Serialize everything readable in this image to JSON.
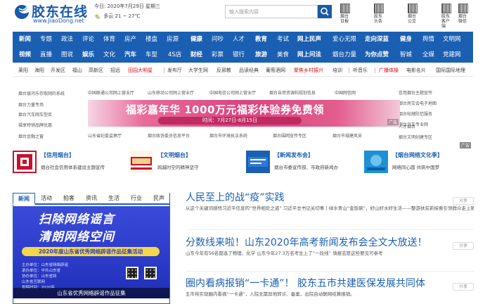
{
  "header": {
    "logo_text": "胶东在线",
    "logo_url": "www.JiaoDong.net",
    "date_label": "今日:",
    "date": "2020年7月29日 星期三",
    "weather": "多云 21 ~ 27℃",
    "search_placeholder": "输入搜索内容",
    "qr_codes": [
      {
        "label": "烟台日报"
      },
      {
        "label": "胶东头条"
      },
      {
        "label": "烟台公交"
      },
      {
        "label": "胶东客户端"
      },
      {
        "label": "烟台微信"
      }
    ]
  },
  "nav": {
    "row1": [
      "新闻",
      "专题",
      "政法",
      "评论",
      "体育",
      "房产",
      "楼盘",
      "房源",
      "健康",
      "问吵",
      "人才",
      "教育",
      "考试",
      "网上民声",
      "爱心无限",
      "走向深蓝",
      "健身",
      "舆情",
      "文明网"
    ],
    "row2": [
      "视频",
      "直播",
      "图说",
      "娱乐",
      "文化",
      "汽车",
      "车型",
      "4S店",
      "财经",
      "彩票",
      "银行",
      "旅游",
      "美食",
      "网上问法",
      "烟台力量",
      "为你点赞",
      "智城",
      "全媒",
      "党建网"
    ]
  },
  "districts": {
    "items": [
      "莱阳",
      "海阳",
      "开发区",
      "福山",
      "高新区",
      "招远",
      "田园大明星",
      "发布厅",
      "大学生网",
      "反邪教",
      "品读经典",
      "葡萄酒网",
      "聚焦乡村振兴",
      "培训",
      "听音乐",
      "广播体操",
      "电影名片",
      "国际国际地理"
    ]
  },
  "ad_links": {
    "left": [
      "烟台银河乐存取网的系统",
      "烟台力量专场",
      "烟台汽车网车型库",
      "福享特销品牌优惠",
      "烟台金融之窗"
    ],
    "top": [
      "中国联通公司网上营业厅",
      "山东移动公司网上营业厅",
      "中国电信公司网上营业厅",
      "烟台自然资源和规划信息",
      "中国网信网"
    ],
    "right": [
      "信用烟台主题宣传",
      "烟台房交会电子地图",
      "烟台帖辖防范服务",
      "烟台汽车专业网",
      "人才烟台",
      "烟台文明创建专区"
    ],
    "bottom": [
      "山东省纪委监察厅",
      "烟台政协委员信息平台",
      "烟台市环境执法系统",
      "烟台围网宣传专区",
      "烟台市城建风采"
    ],
    "banner_title": "福彩嘉年华 1000万元福彩体验券免费领",
    "banner_date": "时间：7月27日-8月15日",
    "banner_tag": "广告",
    "side_tag": "广告"
  },
  "features": [
    {
      "title": "【信用烟台】",
      "desc": "烟台社会信用体系建设主题宣传"
    },
    {
      "title": "【文明烟台】",
      "desc": "跨越时空的精神坚守"
    },
    {
      "title": "【新闻发布会】",
      "desc": "烟台市委宣传部、市政府新闻办"
    },
    {
      "title": "【烟台网络文化季】",
      "desc": "网络同心圆 共筑中国梦"
    }
  ],
  "tabs": [
    "新闻",
    "活动",
    "拍客",
    "资讯",
    "生活",
    "行业",
    "民声"
  ],
  "poster": {
    "line1": "扫除网络谣言",
    "line2": "清朗网络空间",
    "pill": "2020年度山东省优秀网络辟谣作品征集活动",
    "info": [
      "主办单位：山东省网络辟谣",
      "承办单位：中共山东省",
      "协办单位：山东省网",
      "       山东省互联网",
      "投稿时间：2020年"
    ],
    "caption": "山东省优秀网络辟谣作品征集"
  },
  "news": [
    {
      "title": "人民至上的战“疫”实践",
      "desc": "从这个关键词感悟习近平信息的“世界相处之道”     习近平总书记关切事丨绿水青山“金饭碗”，好山好水好生活——整游扶贫新探索引领群众走上致富路",
      "share": "分享"
    },
    {
      "title": "分数线来啦！山东2020年高考新闻发布会全文大放送！",
      "desc": "山东今年有56名都选了物理、化学     山东今年27.3万名考生上了“一段线” 填报志愿这些要见可参考",
      "share": "分享"
    },
    {
      "title": "圈内看病报销“一卡通”！ 胶东五市共建医保发展共同体",
      "desc": "五市将实现圈内看病“一卡通”，入院无需异地转诊、备案，出院自动联网结算报销。",
      "share": "分享"
    }
  ]
}
